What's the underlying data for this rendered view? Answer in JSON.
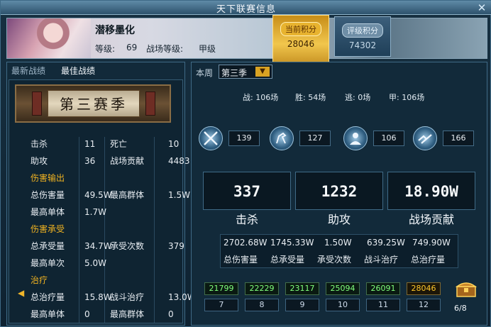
{
  "window": {
    "title": "天下联赛信息"
  },
  "header": {
    "player_name": "潜移墨化",
    "level_label": "等级:",
    "level": "69",
    "rank_label": "战场等级:",
    "rank": "甲级",
    "current_score_label": "当前积分",
    "current_score": "28046",
    "rating_score_label": "评级积分",
    "rating_score": "74302"
  },
  "left": {
    "tabs": [
      "最新战绩",
      "最佳战绩"
    ],
    "season_banner": "第三赛季",
    "rows": [
      {
        "a": "击杀",
        "b": "11",
        "c": "死亡",
        "d": "10"
      },
      {
        "a": "助攻",
        "b": "36",
        "c": "战场贡献",
        "d": "4483"
      },
      {
        "section": "伤害输出"
      },
      {
        "a": "总伤害量",
        "b": "49.5W",
        "c": "最高群体",
        "d": "1.5W"
      },
      {
        "a": "最高单体",
        "b": "1.7W",
        "c": "",
        "d": ""
      },
      {
        "section": "伤害承受"
      },
      {
        "a": "总承受量",
        "b": "34.7W",
        "c": "承受次数",
        "d": "379"
      },
      {
        "a": "最高单次",
        "b": "5.0W",
        "c": "",
        "d": ""
      },
      {
        "section": "治疗"
      },
      {
        "a": "总治疗量",
        "b": "15.8W",
        "c": "战斗治疗",
        "d": "13.0W"
      },
      {
        "a": "最高单体",
        "b": "0",
        "c": "最高群体",
        "d": "0"
      }
    ]
  },
  "right": {
    "week_label": "本周",
    "season_value": "第三季",
    "summary": [
      "战: 106场",
      "胜: 54场",
      "逃: 0场",
      "甲: 106场"
    ],
    "icons": [
      {
        "icon": "crossed-swords-icon",
        "value": "139"
      },
      {
        "icon": "horse-icon",
        "value": "127"
      },
      {
        "icon": "warrior-icon",
        "value": "106"
      },
      {
        "icon": "handshake-icon",
        "value": "166"
      }
    ],
    "big_stats": [
      {
        "value": "337",
        "label": "击杀"
      },
      {
        "value": "1232",
        "label": "助攻"
      },
      {
        "value": "18.90W",
        "label": "战场贡献"
      }
    ],
    "totals": [
      {
        "value": "2702.68W",
        "label": "总伤害量"
      },
      {
        "value": "1745.33W",
        "label": "总承受量"
      },
      {
        "value": "1.50W",
        "label": "承受次数"
      },
      {
        "value": "639.25W",
        "label": "战斗治疗"
      },
      {
        "value": "749.90W",
        "label": "总治疗量"
      }
    ],
    "history": [
      {
        "score": "21799",
        "week": "7"
      },
      {
        "score": "22229",
        "week": "8"
      },
      {
        "score": "23117",
        "week": "9"
      },
      {
        "score": "25094",
        "week": "10"
      },
      {
        "score": "26091",
        "week": "11"
      },
      {
        "score": "28046",
        "week": "12"
      }
    ],
    "chest_count": "6/8"
  },
  "colors": {
    "accent_gold": "#f1b321",
    "score_green": "#80ff7c",
    "score_gold": "#ffc72a"
  }
}
